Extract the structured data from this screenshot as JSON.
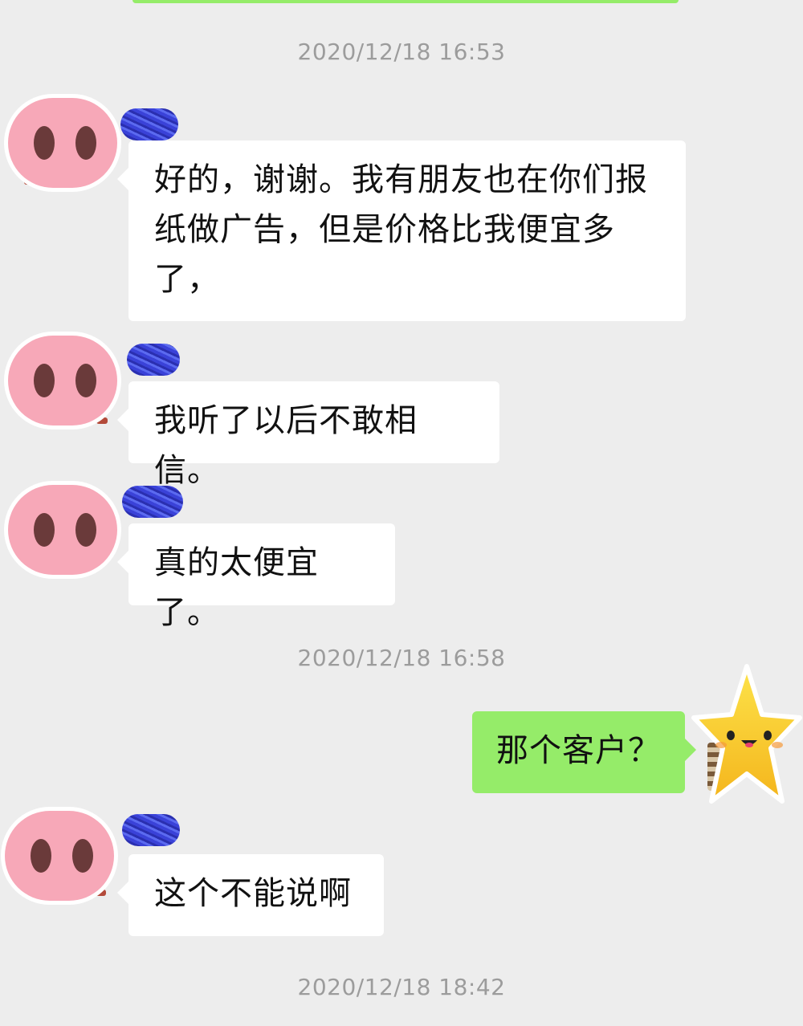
{
  "chat": {
    "timestamps": [
      "2020/12/18 16:53",
      "2020/12/18 16:58",
      "2020/12/18 18:42"
    ],
    "messages": [
      {
        "sender": "contact",
        "lines": [
          "好的，谢谢。我有朋友也在你们报",
          "纸做广告，但是价格比我便宜多",
          "了，"
        ]
      },
      {
        "sender": "contact",
        "lines": [
          "我听了以后不敢相信。"
        ]
      },
      {
        "sender": "contact",
        "lines": [
          "真的太便宜了。"
        ]
      },
      {
        "sender": "me",
        "lines": [
          "那个客户？"
        ]
      },
      {
        "sender": "contact",
        "lines": [
          "这个不能说啊"
        ]
      }
    ]
  },
  "avatars": {
    "contact": "pig-nose-icon",
    "me": "star-face-icon"
  },
  "colors": {
    "background": "#ededed",
    "incoming_bubble": "#ffffff",
    "outgoing_bubble": "#95ec69",
    "timestamp_text": "#9c9c9c",
    "name_redaction": "#3a42d8"
  }
}
